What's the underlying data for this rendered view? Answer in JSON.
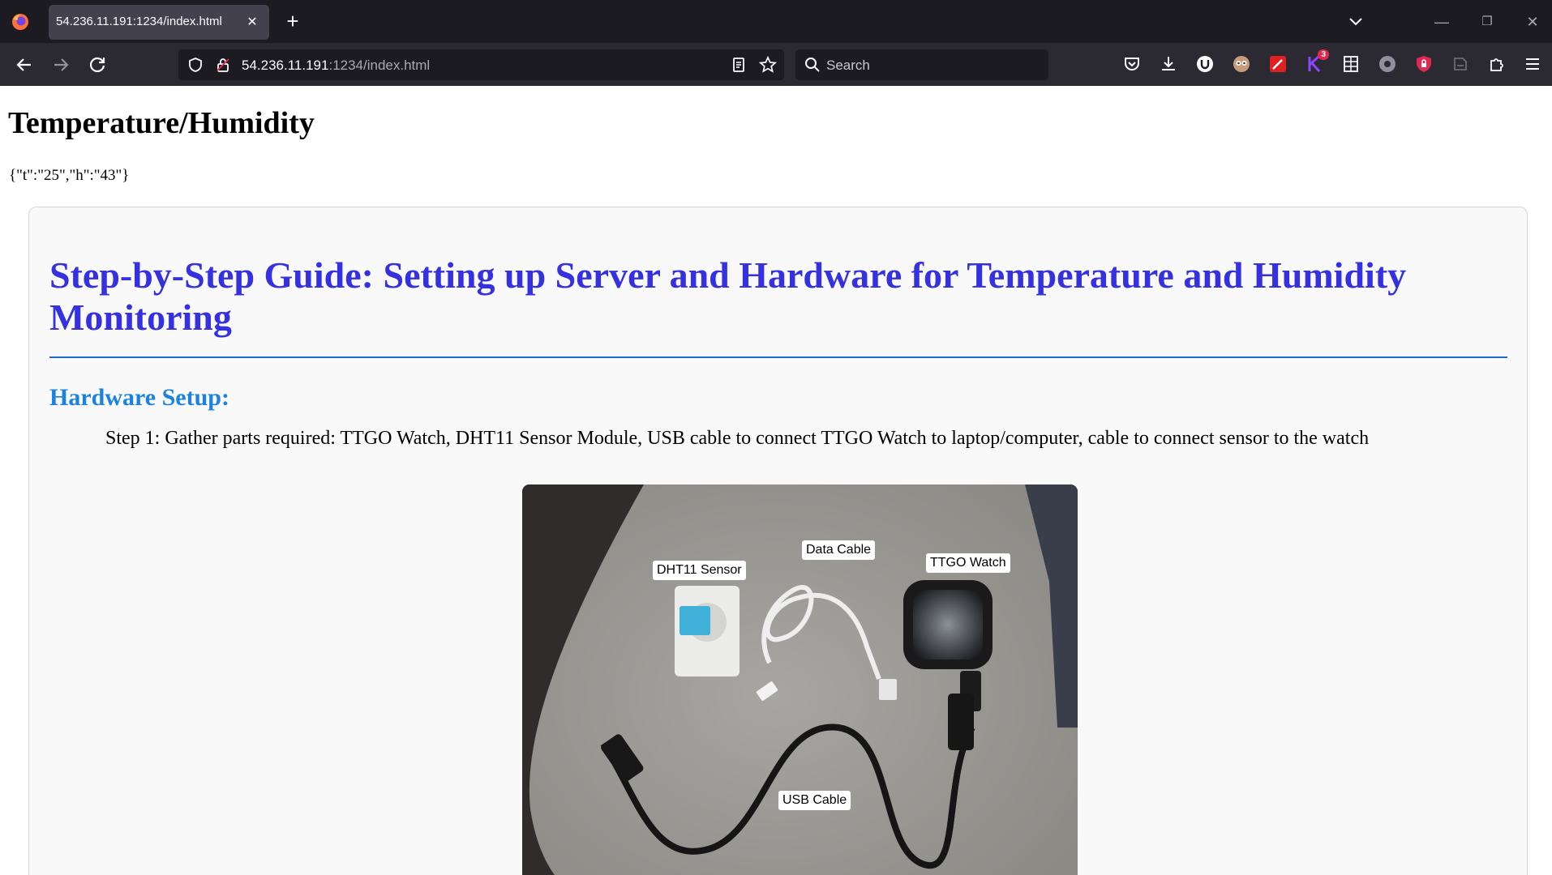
{
  "browser": {
    "tab_title": "54.236.11.191:1234/index.html",
    "url_host": "54.236.11.191",
    "url_rest": ":1234/index.html",
    "search_placeholder": "Search",
    "extension_badge": "3"
  },
  "page": {
    "heading": "Temperature/Humidity",
    "json_readout": "{\"t\":\"25\",\"h\":\"43\"}",
    "guide_title": "Step-by-Step Guide: Setting up Server and Hardware for Temperature and Humidity Monitoring",
    "hardware_heading": "Hardware Setup:",
    "step1": "Step 1: Gather parts required: TTGO Watch, DHT11 Sensor Module, USB cable to connect TTGO Watch to laptop/computer, cable to connect sensor to the watch",
    "photo_labels": {
      "sensor": "DHT11 Sensor",
      "data_cable": "Data Cable",
      "watch": "TTGO Watch",
      "usb_cable": "USB Cable"
    }
  },
  "colors": {
    "guide_title": "#3530e0",
    "hardware_heading": "#1c82e0",
    "rule": "#1b6ad6",
    "tab_strip": "#1c1b22",
    "nav_bar": "#2b2a33"
  },
  "icons": [
    "firefox-logo-icon",
    "close-icon",
    "plus-icon",
    "chevron-down-icon",
    "minimize-icon",
    "restore-icon",
    "close-window-icon",
    "back-arrow-icon",
    "forward-arrow-icon",
    "reload-icon",
    "shield-icon",
    "lock-icon",
    "reader-view-icon",
    "star-icon",
    "search-icon",
    "pocket-icon",
    "download-icon",
    "extension-icons",
    "puzzle-icon",
    "menu-icon"
  ]
}
